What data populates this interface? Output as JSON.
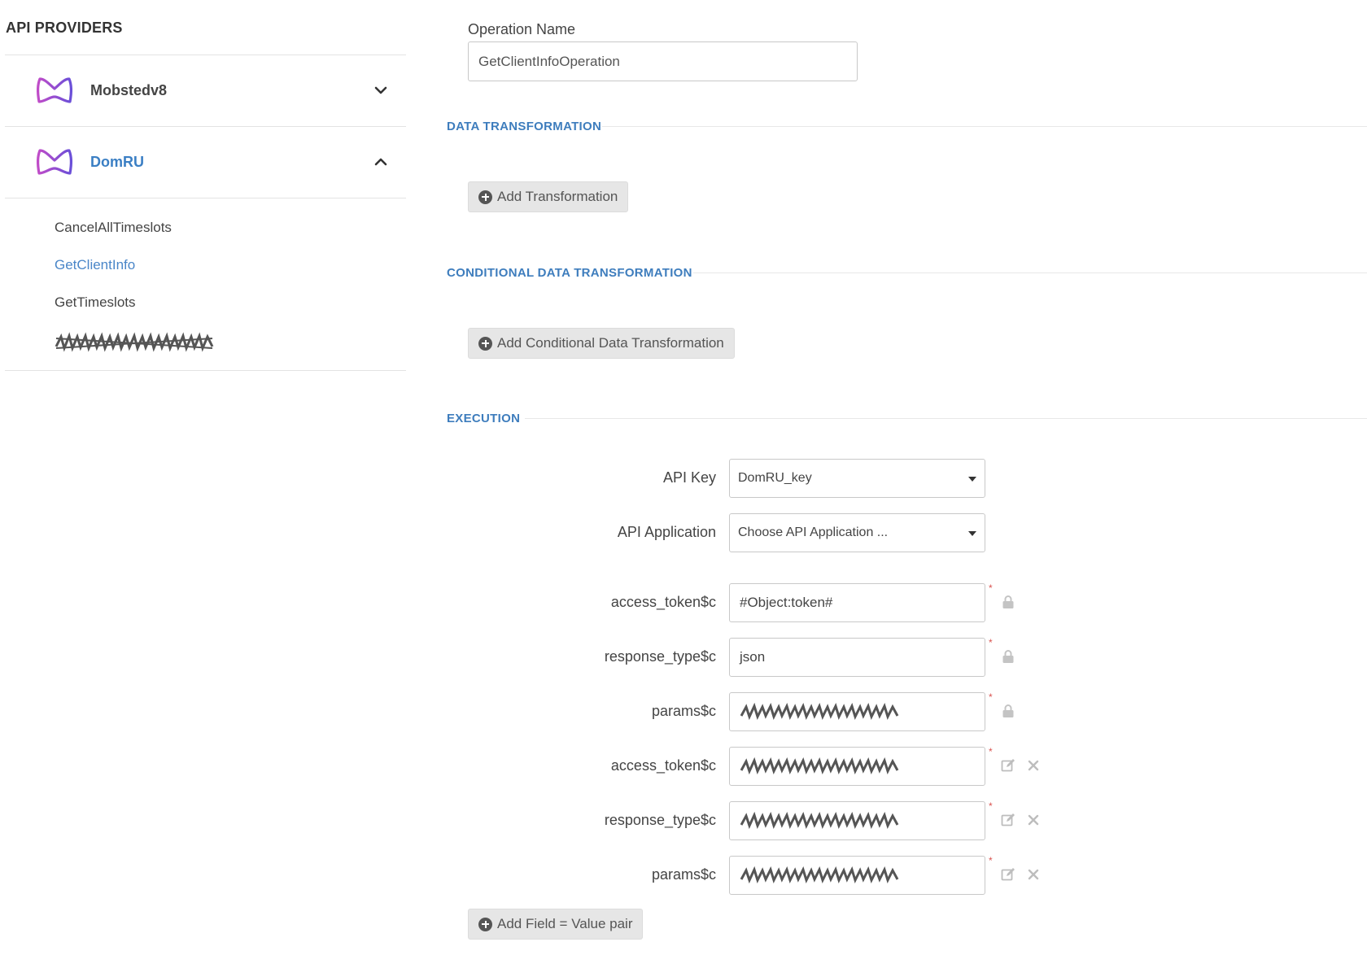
{
  "sidebar": {
    "title": "API PROVIDERS",
    "providers": [
      {
        "name": "Mobstedv8",
        "expanded": false,
        "icon": "chevron-down-icon"
      },
      {
        "name": "DomRU",
        "expanded": true,
        "icon": "chevron-up-icon"
      }
    ],
    "operations": [
      "CancelAllTimeslots",
      "GetClientInfo",
      "GetTimeslots"
    ],
    "active_operation": "GetClientInfo"
  },
  "form": {
    "operation_name_label": "Operation Name",
    "operation_name_value": "GetClientInfoOperation"
  },
  "sections": {
    "data_transformation": "DATA TRANSFORMATION",
    "add_transformation": "Add Transformation",
    "conditional": "CONDITIONAL DATA TRANSFORMATION",
    "add_conditional": "Add Conditional Data Transformation",
    "execution": "EXECUTION"
  },
  "execution": {
    "api_key_label": "API Key",
    "api_key_value": "DomRU_key",
    "api_app_label": "API Application",
    "api_app_value": "Choose API Application ...",
    "locked_fields": [
      {
        "label": "access_token$c",
        "value": "#Object:token#"
      },
      {
        "label": "response_type$c",
        "value": "json"
      },
      {
        "label": "params$c",
        "value": ""
      }
    ],
    "editable_fields": [
      {
        "label": "access_token$c",
        "value": ""
      },
      {
        "label": "response_type$c",
        "value": ""
      },
      {
        "label": "params$c",
        "value": ""
      }
    ],
    "required_mark": "*",
    "add_pair": "Add Field = Value pair"
  },
  "colors": {
    "accent": "#3e7dbd",
    "logo": "#b04fcf",
    "required": "#d9534f"
  }
}
